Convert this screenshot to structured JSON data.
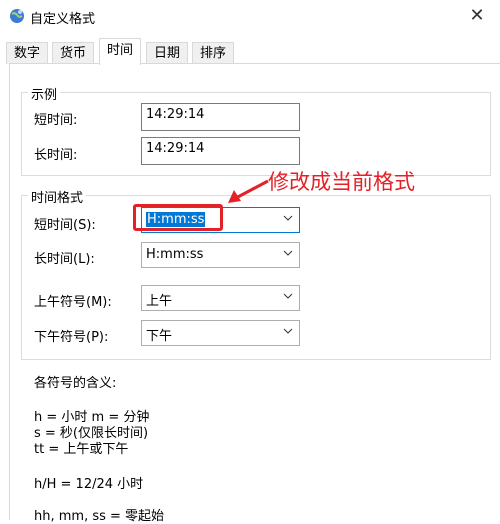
{
  "window": {
    "title": "自定义格式",
    "close": "✕"
  },
  "tabs": [
    "数字",
    "货币",
    "时间",
    "日期",
    "排序"
  ],
  "example": {
    "legend": "示例",
    "short_label": "短时间:",
    "short_value": "14:29:14",
    "long_label": "长时间:",
    "long_value": "14:29:14"
  },
  "format": {
    "legend": "时间格式",
    "short_label": "短时间(S):",
    "short_value": "H:mm:ss",
    "long_label": "长时间(L):",
    "long_value": "H:mm:ss",
    "am_label": "上午符号(M):",
    "am_value": "上午",
    "pm_label": "下午符号(P):",
    "pm_value": "下午"
  },
  "annotation": "修改成当前格式",
  "notes": {
    "heading": "各符号的含义:",
    "line1": "h = 小时   m = 分钟",
    "line2": "s = 秒(仅限长时间)",
    "line3": "tt = 上午或下午",
    "line4": "h/H = 12/24 小时",
    "line5": "hh, mm, ss = 零起始"
  },
  "colors": {
    "annotation": "#e32228",
    "selection": "#0078d7"
  }
}
